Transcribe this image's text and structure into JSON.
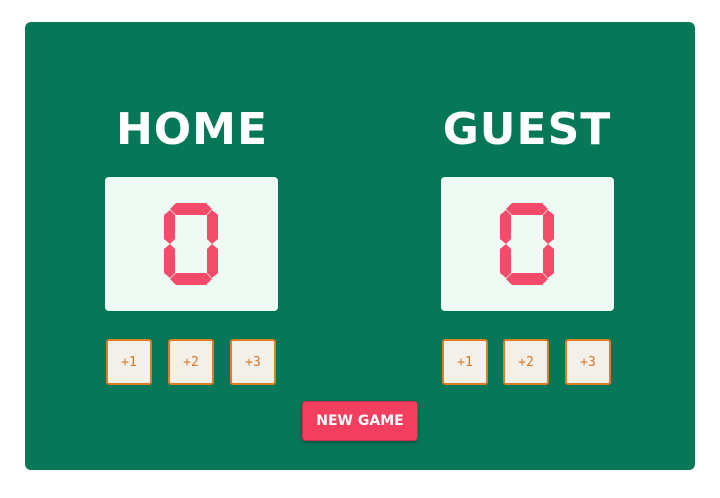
{
  "home": {
    "title": "HOME",
    "score": "0",
    "buttons": [
      "+1",
      "+2",
      "+3"
    ]
  },
  "guest": {
    "title": "GUEST",
    "score": "0",
    "buttons": [
      "+1",
      "+2",
      "+3"
    ]
  },
  "new_game_label": "NEW GAME",
  "colors": {
    "board": "#067757",
    "score_background": "#eefaf4",
    "score_digit": "#f44b6a",
    "point_button_border": "#de7c28",
    "new_game_button": "#f23e5f"
  }
}
